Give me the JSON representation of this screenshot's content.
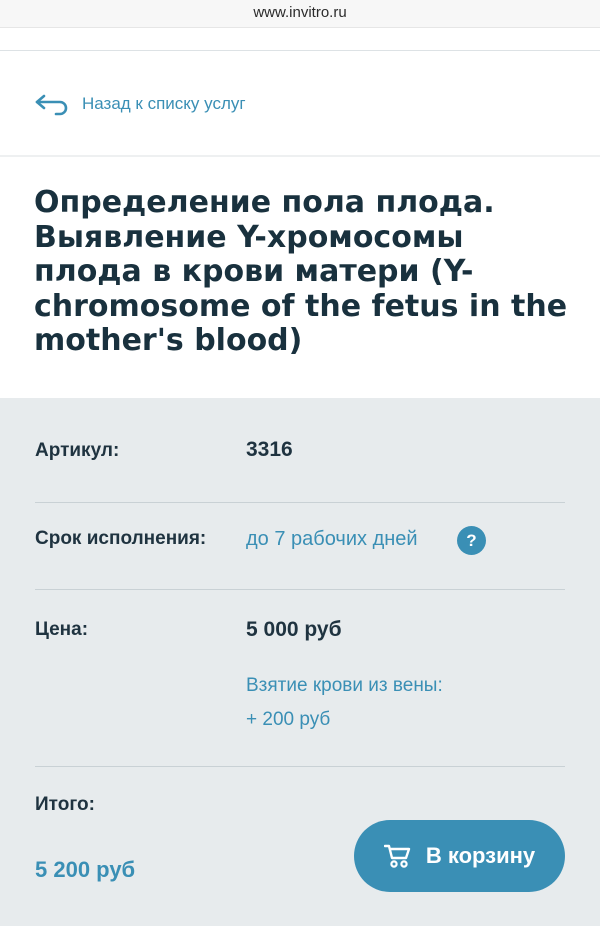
{
  "browser": {
    "url": "www.invitro.ru"
  },
  "nav": {
    "back_label": "Назад к списку услуг"
  },
  "product": {
    "title": "Определение пола плода. Выявление Y-хромосомы плода в крови матери (Y-chromosome of the fetus in the mother's blood)"
  },
  "details": {
    "article_label": "Артикул:",
    "article_value": "3316",
    "deadline_label": "Срок исполнения:",
    "deadline_value": "до 7 рабочих дней",
    "help_symbol": "?",
    "price_label": "Цена:",
    "price_value": "5 000 руб",
    "blood_note_line1": "Взятие крови из вены:",
    "blood_note_line2": "+ 200 руб",
    "total_label": "Итого:",
    "total_value": "5 200 руб"
  },
  "actions": {
    "cart_label": "В корзину"
  },
  "colors": {
    "accent": "#3a8fb5",
    "panel": "#e7ebed",
    "text": "#1f3340"
  },
  "icons": {
    "back": "back-arrow-icon",
    "help": "question-icon",
    "cart": "cart-icon"
  }
}
